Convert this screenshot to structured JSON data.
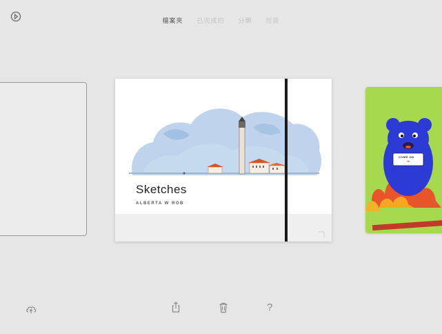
{
  "top_tabs": [
    {
      "label": "檔案夾",
      "active": true
    },
    {
      "label": "已完成的",
      "active": false
    },
    {
      "label": "分類",
      "active": false
    },
    {
      "label": "垃圾",
      "active": false
    }
  ],
  "main_card": {
    "title": "Sketches",
    "author": "ALBERTA W ROB",
    "band_color": "#1a1a1a"
  },
  "right_card": {
    "sign_text": "COME ON"
  },
  "colors": {
    "background": "#e6e6e6",
    "right_card_green": "#a6d94e",
    "bear_blue": "#2d3bd6",
    "book_red": "#c0392b"
  },
  "icons": {
    "top_left": "play-circle-icon",
    "bottom_left": "cloud-upload-icon",
    "share": "share-icon",
    "trash": "trash-icon"
  },
  "toolbar": {
    "help_label": "?"
  }
}
